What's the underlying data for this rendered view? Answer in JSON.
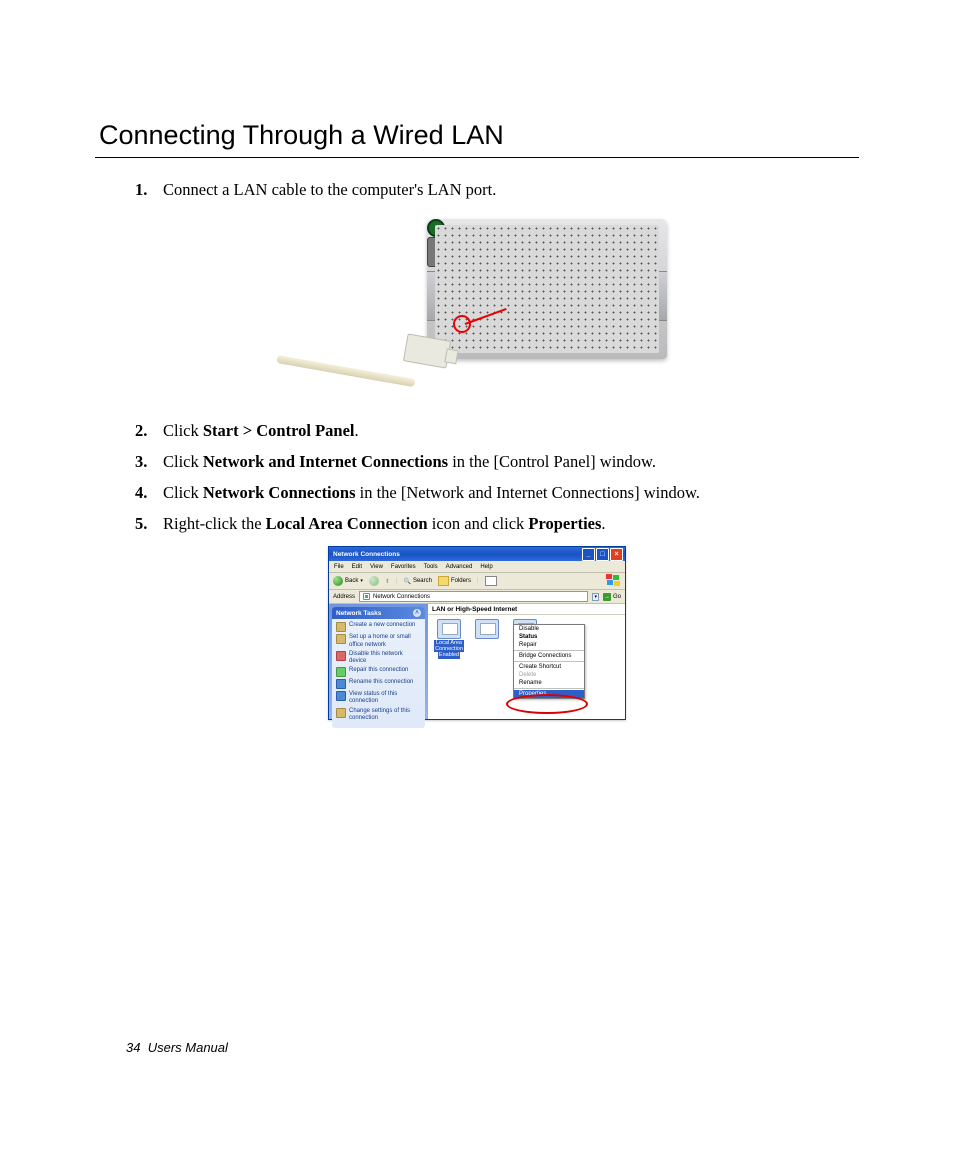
{
  "page": {
    "title": "Connecting Through a Wired LAN",
    "footer_page_number": "34",
    "footer_label": "Users Manual"
  },
  "steps": {
    "s1": {
      "num": "1.",
      "text": "Connect a LAN cable to the computer's LAN port."
    },
    "s2": {
      "num": "2.",
      "pre": "Click ",
      "b1": "Start > Control Panel",
      "post": "."
    },
    "s3": {
      "num": "3.",
      "pre": "Click ",
      "b1": "Network and Internet Connections",
      "post": " in the [Control Panel] window."
    },
    "s4": {
      "num": "4.",
      "pre": "Click ",
      "b1": "Network Connections",
      "post": " in the [Network and Internet Connections] window."
    },
    "s5": {
      "num": "5.",
      "pre": "Right-click the ",
      "b1": "Local Area Connection",
      "mid": " icon and click ",
      "b2": "Properties",
      "post": "."
    }
  },
  "xp": {
    "title": "Network Connections",
    "menus": [
      "File",
      "Edit",
      "View",
      "Favorites",
      "Tools",
      "Advanced",
      "Help"
    ],
    "toolbar": {
      "back": "Back",
      "search": "Search",
      "folders": "Folders"
    },
    "address_label": "Address",
    "address_value": "Network Connections",
    "go_label": "Go",
    "sidebar": {
      "header": "Network Tasks",
      "items": [
        "Create a new connection",
        "Set up a home or small office network",
        "Disable this network device",
        "Repair this connection",
        "Rename this connection",
        "View status of this connection",
        "Change settings of this connection"
      ]
    },
    "content": {
      "category": "LAN or High-Speed Internet",
      "connection": {
        "name": "Local Area Connection",
        "status": "Enabled"
      }
    },
    "context_menu": {
      "disable": "Disable",
      "status": "Status",
      "repair": "Repair",
      "bridge": "Bridge Connections",
      "shortcut": "Create Shortcut",
      "delete": "Delete",
      "rename": "Rename",
      "properties": "Properties"
    }
  }
}
